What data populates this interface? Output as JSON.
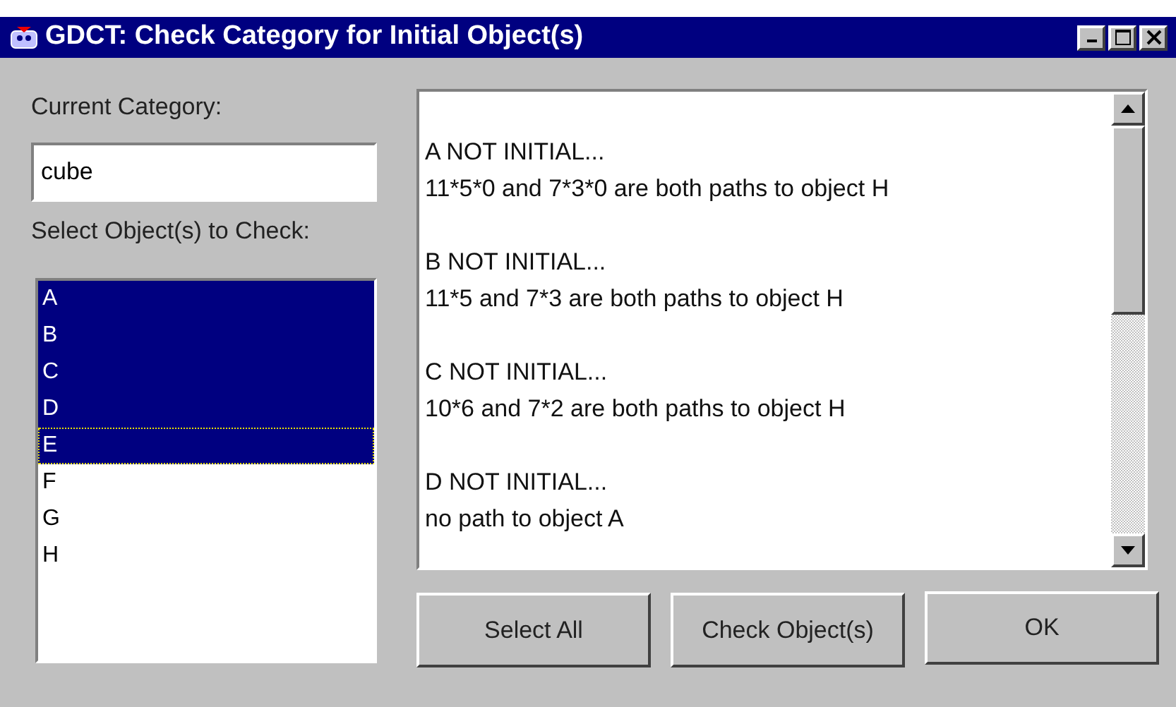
{
  "window": {
    "title": "GDCT: Check Category for Initial Object(s)"
  },
  "category": {
    "label": "Current Category:",
    "value": "cube"
  },
  "objects": {
    "label": "Select Object(s) to Check:",
    "items": [
      {
        "label": "A",
        "selected": true,
        "focused": false
      },
      {
        "label": "B",
        "selected": true,
        "focused": false
      },
      {
        "label": "C",
        "selected": true,
        "focused": false
      },
      {
        "label": "D",
        "selected": true,
        "focused": false
      },
      {
        "label": "E",
        "selected": true,
        "focused": true
      },
      {
        "label": "F",
        "selected": false,
        "focused": false
      },
      {
        "label": "G",
        "selected": false,
        "focused": false
      },
      {
        "label": "H",
        "selected": false,
        "focused": false
      }
    ]
  },
  "results": [
    {
      "heading": "A NOT INITIAL...",
      "detail": "11*5*0 and 7*3*0 are both paths to object H"
    },
    {
      "heading": "B NOT INITIAL...",
      "detail": "11*5 and 7*3 are both paths to object H"
    },
    {
      "heading": "C NOT INITIAL...",
      "detail": "10*6 and 7*2 are both paths to object H"
    },
    {
      "heading": "D NOT INITIAL...",
      "detail": "no path to object A"
    }
  ],
  "buttons": [
    "Select All",
    "Check Object(s)",
    "OK"
  ]
}
